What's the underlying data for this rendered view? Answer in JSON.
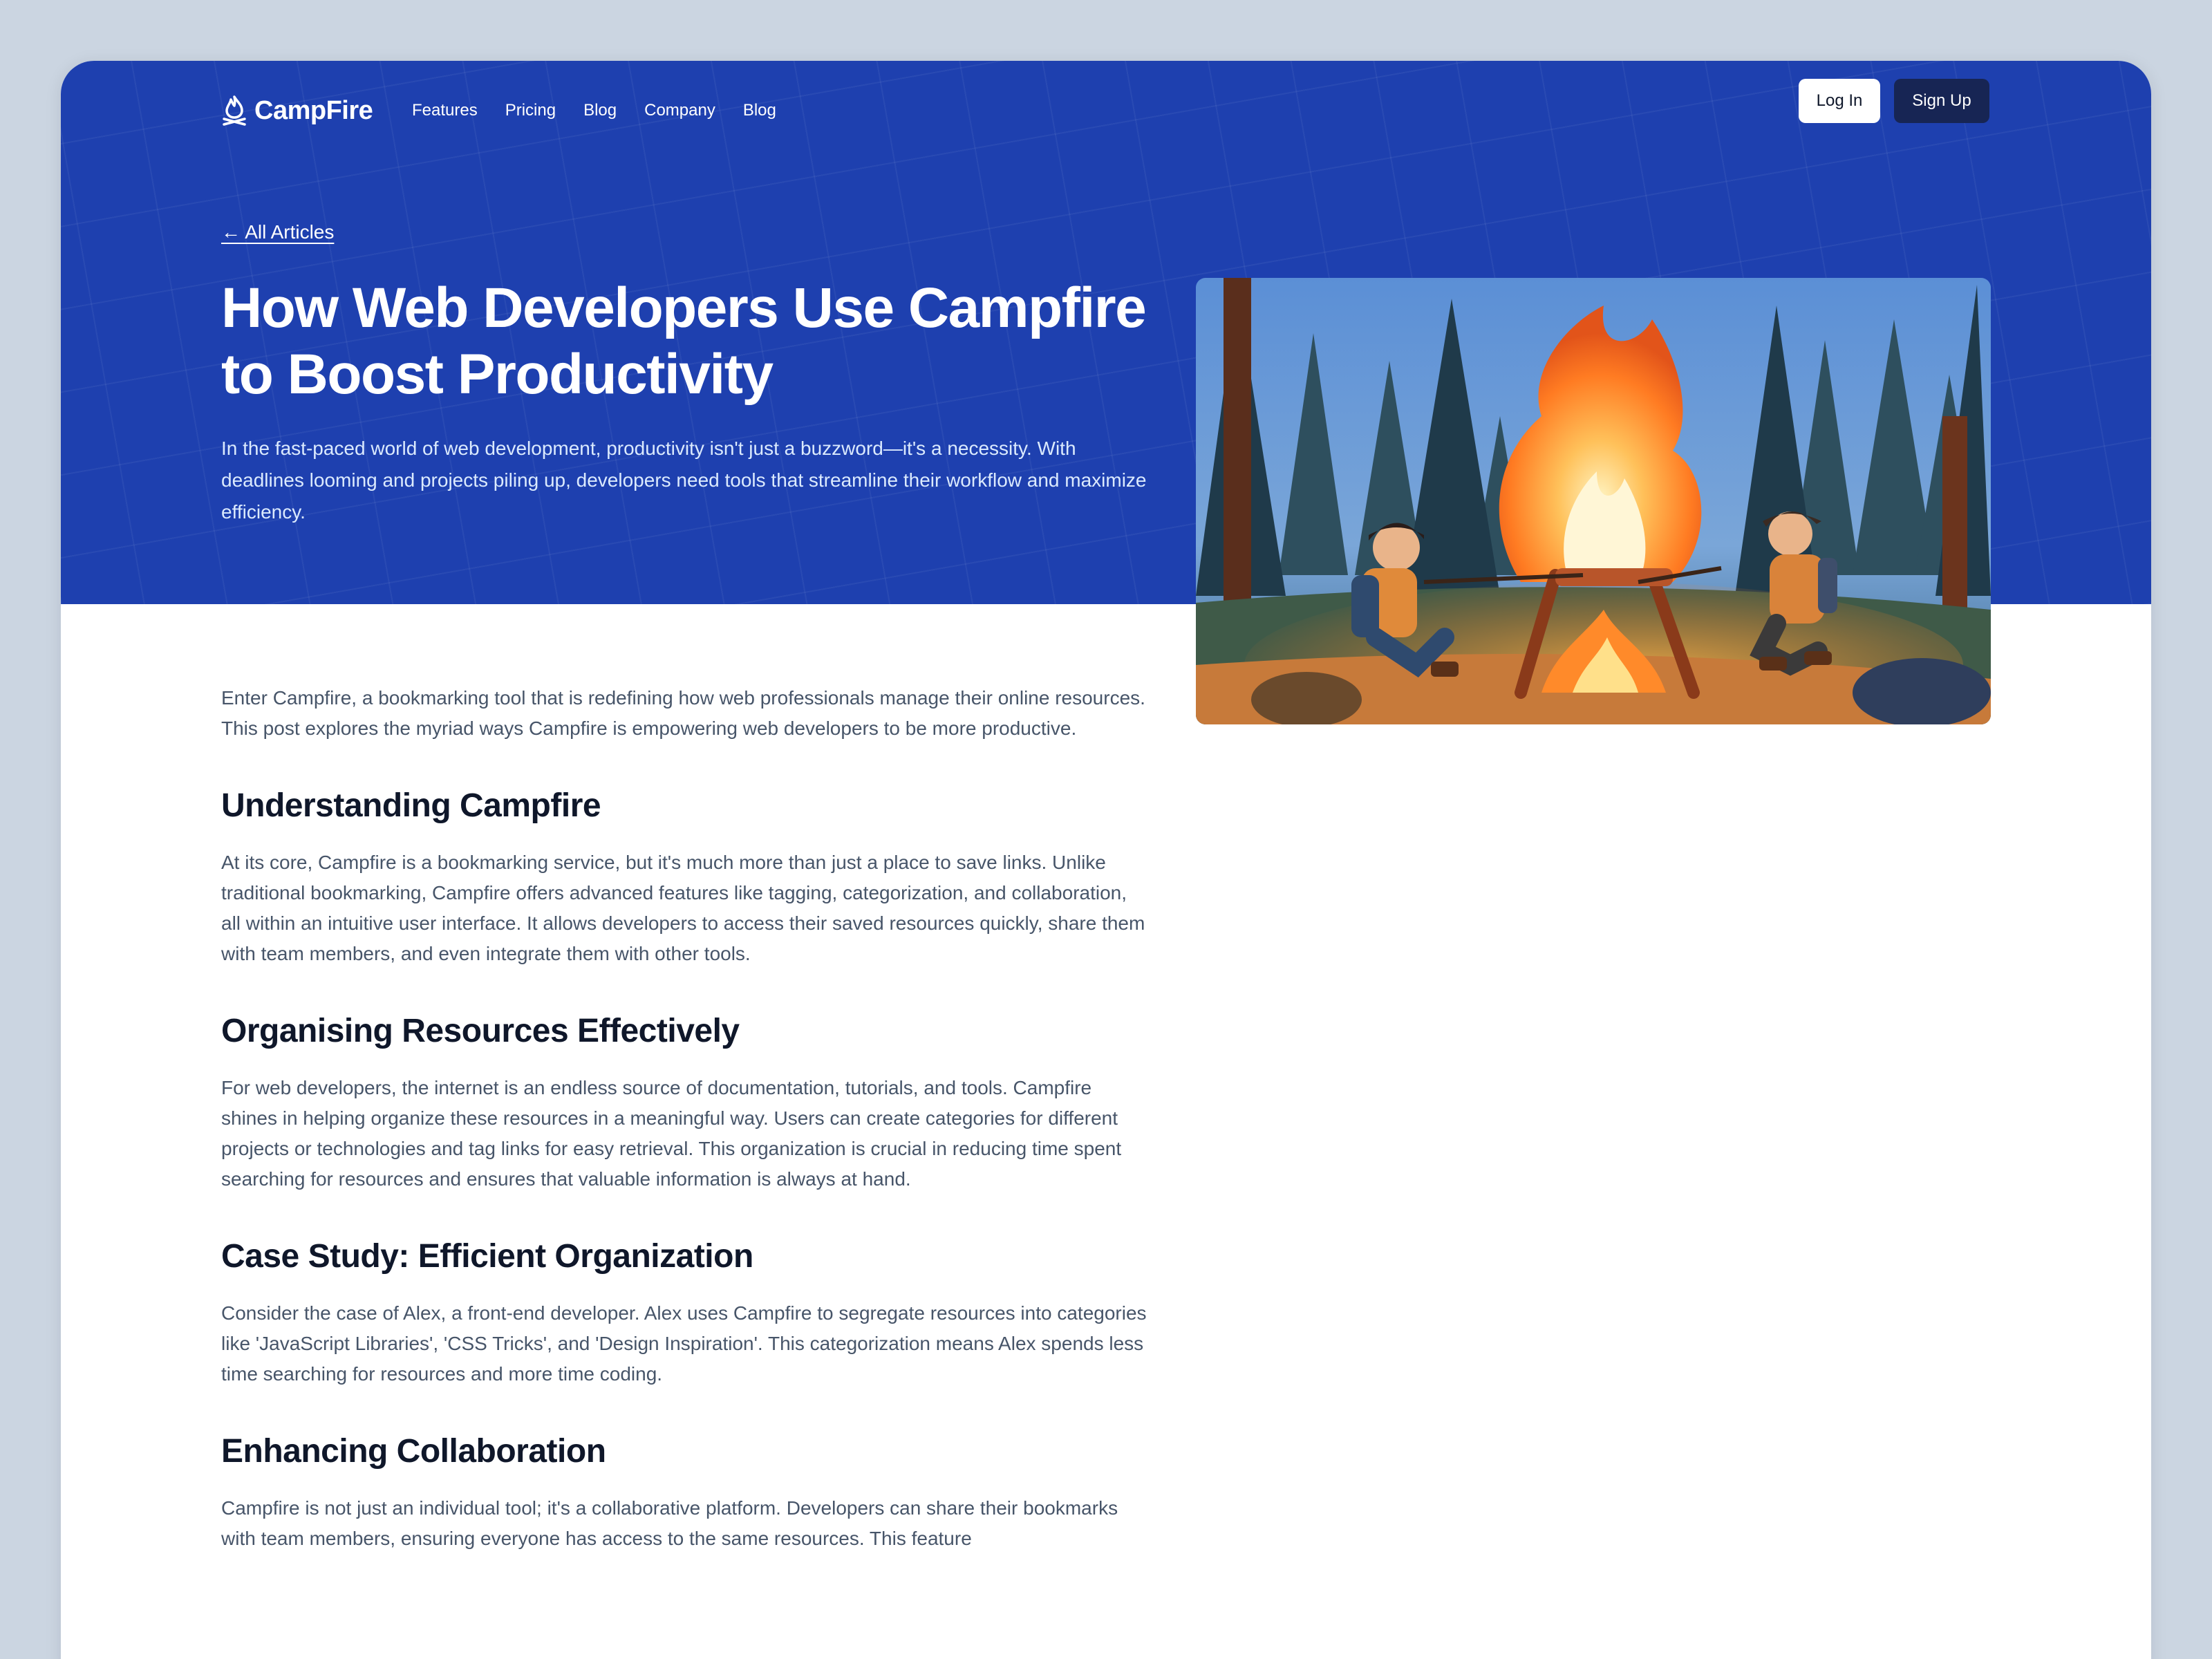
{
  "nav": {
    "brand": "CampFire",
    "links": [
      "Features",
      "Pricing",
      "Blog",
      "Company",
      "Blog"
    ],
    "login_label": "Log In",
    "signup_label": "Sign Up"
  },
  "hero": {
    "back_link": "← All Articles",
    "title": "How Web Developers Use Campfire to Boost Productivity",
    "lede": "In the fast-paced world of web development, productivity isn't just a buzzword—it's a necessity. With deadlines looming and projects piling up, developers need tools that streamline their workflow and maximize efficiency."
  },
  "article": {
    "intro": "Enter Campfire, a bookmarking tool that is redefining how web professionals manage their online resources. This post explores the myriad ways Campfire is empowering web developers to be more productive.",
    "sections": [
      {
        "heading": "Understanding Campfire",
        "body": "At its core, Campfire is a bookmarking service, but it's much more than just a place to save links. Unlike traditional bookmarking, Campfire offers advanced features like tagging, categorization, and collaboration, all within an intuitive user interface. It allows developers to access their saved resources quickly, share them with team members, and even integrate them with other tools."
      },
      {
        "heading": "Organising Resources Effectively",
        "body": "For web developers, the internet is an endless source of documentation, tutorials, and tools. Campfire shines in helping organize these resources in a meaningful way. Users can create categories for different projects or technologies and tag links for easy retrieval. This organization is crucial in reducing time spent searching for resources and ensures that valuable information is always at hand."
      },
      {
        "heading": "Case Study: Efficient Organization",
        "body": "Consider the case of Alex, a front-end developer. Alex uses Campfire to segregate resources into categories like 'JavaScript Libraries', 'CSS Tricks', and 'Design Inspiration'. This categorization means Alex spends less time searching for resources and more time coding."
      },
      {
        "heading": "Enhancing Collaboration",
        "body": "Campfire is not just an individual tool; it's a collaborative platform. Developers can share their bookmarks with team members, ensuring everyone has access to the same resources. This feature"
      }
    ]
  },
  "colors": {
    "hero_bg": "#1e40af",
    "signup_bg": "#172554",
    "page_bg": "#cbd5e1",
    "heading_text": "#0f172a",
    "body_text": "#475569"
  },
  "icons": {
    "brand": "campfire-flame-icon",
    "back": "arrow-left-icon"
  }
}
